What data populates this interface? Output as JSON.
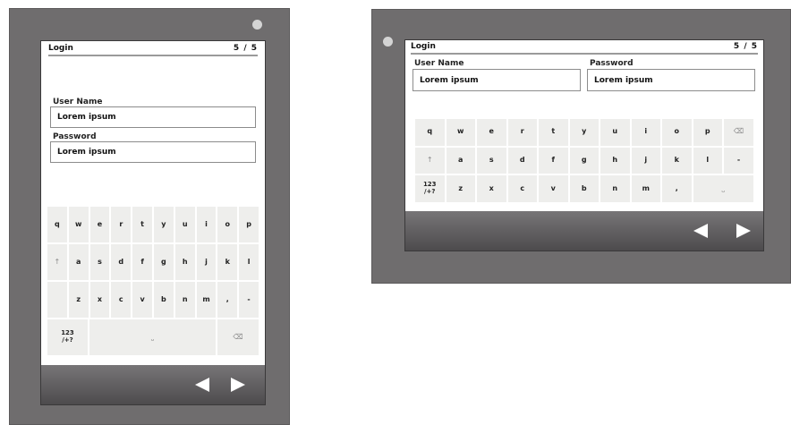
{
  "colors": {
    "device": "#6f6d6e",
    "nav_bar": "#5f5d5f",
    "key": "#eeeeec",
    "screen": "#ffffff"
  },
  "portrait": {
    "header": {
      "title": "Login",
      "page": "5 / 5"
    },
    "username": {
      "label": "User Name",
      "value": "Lorem ipsum"
    },
    "password": {
      "label": "Password",
      "value": "Lorem ipsum"
    },
    "keys": {
      "row1": [
        "q",
        "w",
        "e",
        "r",
        "t",
        "y",
        "u",
        "i",
        "o",
        "p"
      ],
      "row2": [
        "↑",
        "a",
        "s",
        "d",
        "f",
        "g",
        "h",
        "j",
        "k",
        "l"
      ],
      "row3": [
        "z",
        "x",
        "c",
        "v",
        "b",
        "n",
        "m",
        ",",
        "-"
      ],
      "row4": [
        "123 /+?",
        "⎵",
        "⌫"
      ]
    },
    "nav": {
      "prev_icon": "left-arrow-icon",
      "next_icon": "right-arrow-icon"
    }
  },
  "landscape": {
    "header": {
      "title": "Login",
      "page": "5 / 5"
    },
    "username": {
      "label": "User Name",
      "value": "Lorem ipsum"
    },
    "password": {
      "label": "Password",
      "value": "Lorem ipsum"
    },
    "keys": {
      "row1": [
        "q",
        "w",
        "e",
        "r",
        "t",
        "y",
        "u",
        "i",
        "o",
        "p",
        "⌫"
      ],
      "row2": [
        "↑",
        "a",
        "s",
        "d",
        "f",
        "g",
        "h",
        "j",
        "k",
        "l",
        "-"
      ],
      "row3": [
        "123 /+?",
        "z",
        "x",
        "c",
        "v",
        "b",
        "n",
        "m",
        ",",
        "⎵"
      ]
    },
    "nav": {
      "prev_icon": "left-arrow-icon",
      "next_icon": "right-arrow-icon"
    }
  }
}
